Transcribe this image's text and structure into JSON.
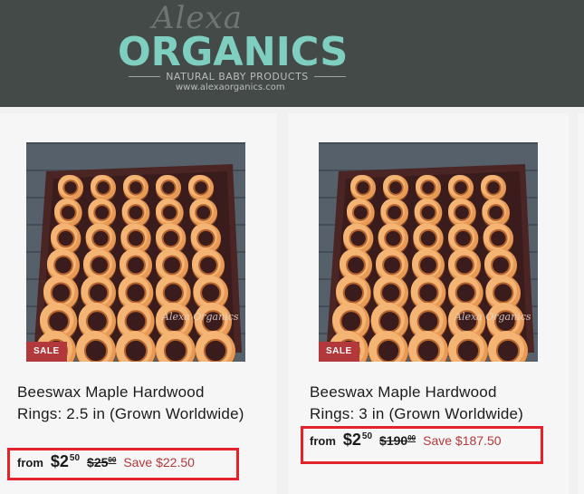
{
  "header": {
    "logo_script": "Alexa",
    "logo_main": "ORGANICS",
    "logo_tagline": "NATURAL BABY PRODUCTS",
    "logo_url": "www.alexaorganics.com",
    "bg_color": "#444a47",
    "accent_color": "#7ecfc0"
  },
  "products": [
    {
      "badge": "SALE",
      "watermark": "Alexa Organics",
      "title": "Beeswax Maple Hardwood Rings: 2.5 in (Grown Worldwide)",
      "price_prefix": "from",
      "price_main": "$2",
      "price_cents": "50",
      "compare_main": "$25",
      "compare_cents": "00",
      "save_text": "Save $22.50"
    },
    {
      "badge": "SALE",
      "watermark": "Alexa Organics",
      "title": "Beeswax Maple Hardwood Rings: 3 in (Grown Worldwide)",
      "price_prefix": "from",
      "price_main": "$2",
      "price_cents": "50",
      "compare_main": "$190",
      "compare_cents": "00",
      "save_text": "Save $187.50"
    }
  ],
  "colors": {
    "sale": "#b2383b",
    "highlight": "#e3232a"
  }
}
